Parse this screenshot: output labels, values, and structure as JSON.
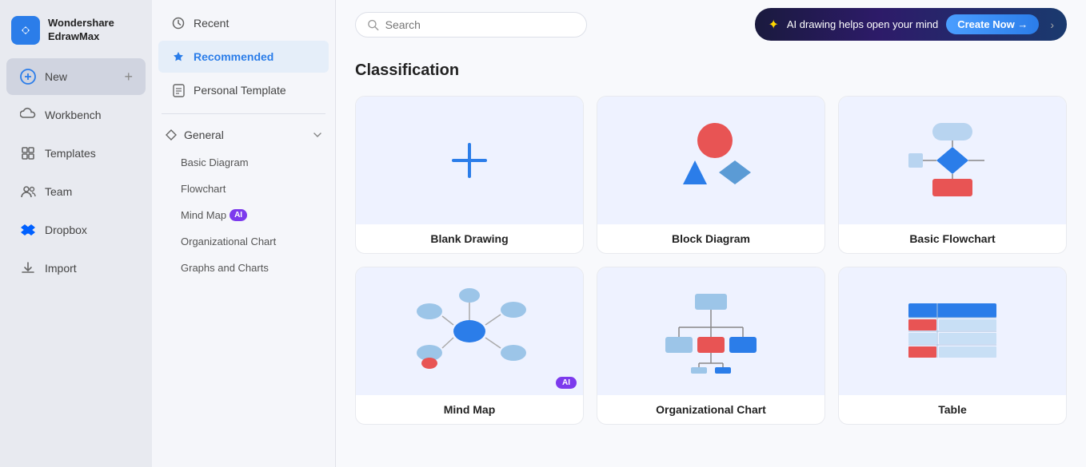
{
  "app": {
    "name": "Wondershare",
    "subname": "EdrawMax",
    "logo_char": "E"
  },
  "left_sidebar": {
    "items": [
      {
        "id": "new",
        "label": "New",
        "icon": "plus-circle-icon"
      },
      {
        "id": "workbench",
        "label": "Workbench",
        "icon": "cloud-icon"
      },
      {
        "id": "templates",
        "label": "Templates",
        "icon": "template-icon"
      },
      {
        "id": "team",
        "label": "Team",
        "icon": "team-icon"
      },
      {
        "id": "dropbox",
        "label": "Dropbox",
        "icon": "dropbox-icon"
      },
      {
        "id": "import",
        "label": "Import",
        "icon": "import-icon"
      }
    ]
  },
  "middle_panel": {
    "items": [
      {
        "id": "recent",
        "label": "Recent",
        "icon": "clock-icon",
        "active": false
      },
      {
        "id": "recommended",
        "label": "Recommended",
        "icon": "star-icon",
        "active": true
      },
      {
        "id": "personal",
        "label": "Personal Template",
        "icon": "document-icon",
        "active": false
      }
    ],
    "sections": [
      {
        "id": "general",
        "label": "General",
        "expanded": true,
        "sub_items": [
          {
            "id": "basic-diagram",
            "label": "Basic Diagram"
          },
          {
            "id": "flowchart",
            "label": "Flowchart"
          },
          {
            "id": "mind-map",
            "label": "Mind Map",
            "has_ai": true
          },
          {
            "id": "org-chart",
            "label": "Organizational Chart"
          },
          {
            "id": "graphs-charts",
            "label": "Graphs and Charts"
          }
        ]
      }
    ]
  },
  "top_bar": {
    "search_placeholder": "Search",
    "ai_banner_text": "AI drawing helps open your mind",
    "create_now_label": "Create Now →"
  },
  "main": {
    "section_title": "Classification",
    "cards": [
      {
        "id": "blank-drawing",
        "label": "Blank Drawing",
        "type": "blank"
      },
      {
        "id": "block-diagram",
        "label": "Block Diagram",
        "type": "block"
      },
      {
        "id": "basic-flowchart",
        "label": "Basic Flowchart",
        "type": "flowchart"
      },
      {
        "id": "mind-map-card",
        "label": "Mind Map",
        "type": "mindmap",
        "has_ai": true
      },
      {
        "id": "org-chart-card",
        "label": "Organizational Chart",
        "type": "orgchart"
      },
      {
        "id": "table-card",
        "label": "Table",
        "type": "table"
      }
    ]
  },
  "colors": {
    "accent": "#2b7de9",
    "purple": "#7c3aed",
    "bg_light": "#f0f4ff",
    "sidebar_bg": "#e8eaf0"
  }
}
